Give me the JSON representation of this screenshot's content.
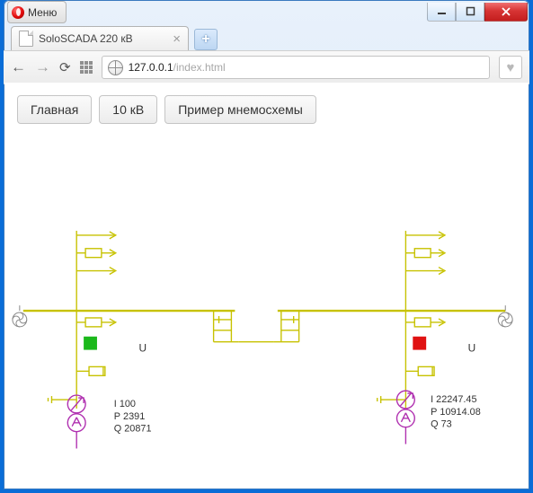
{
  "chrome": {
    "menu_label": "Меню",
    "tab_title": "SoloSCADA 220 кВ",
    "url_host": "127.0.0.1",
    "url_path": "/index.html"
  },
  "nav": {
    "btn_main": "Главная",
    "btn_10kv": "10 кВ",
    "btn_example": "Пример мнемосхемы"
  },
  "scada": {
    "left": {
      "u_label": "U",
      "u_value": "",
      "i_label": "I",
      "i_value": "100",
      "p_label": "P",
      "p_value": "2391",
      "q_label": "Q",
      "q_value": "20871",
      "status_color": "#1bb81b"
    },
    "right": {
      "u_label": "U",
      "u_value": "",
      "i_label": "I",
      "i_value": "22247.45",
      "p_label": "P",
      "p_value": "10914.08",
      "q_label": "Q",
      "q_value": "73",
      "status_color": "#e01212"
    },
    "line_color": "#c7c200",
    "aux_color": "#b030b0"
  }
}
